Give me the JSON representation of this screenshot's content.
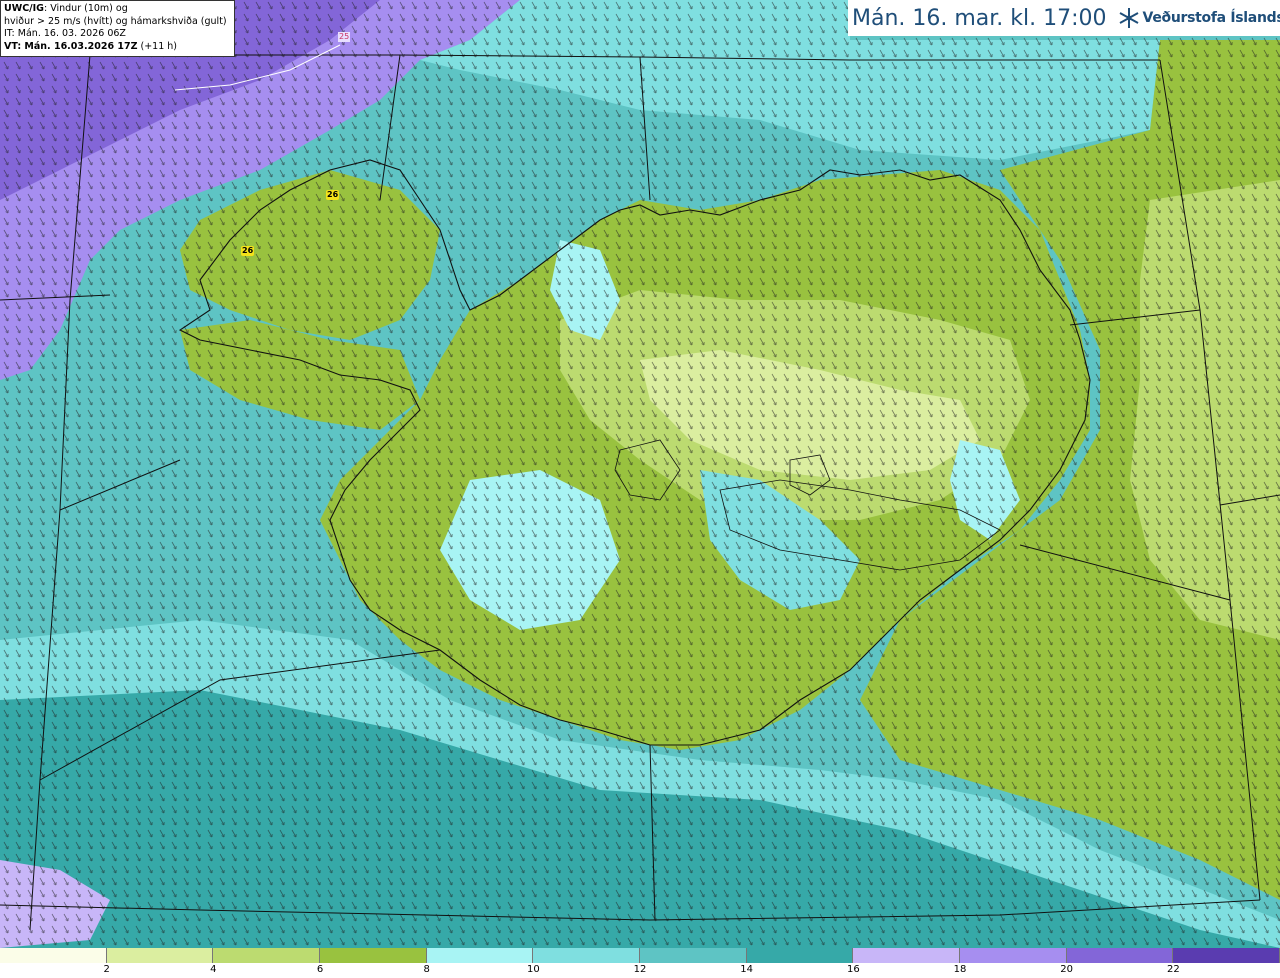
{
  "info_box": {
    "line1_bold": "UWC/IG",
    "line1_rest": ": Vindur (10m) og",
    "line2": "hviður > 25 m/s (hvítt) og hámarkshviða (gult)",
    "line3": "IT: Mán. 16. 03. 2026 06Z",
    "line4_bold": "VT: Mán. 16.03.2026 17Z",
    "line4_rest": " (+11 h)"
  },
  "title": {
    "valid_time": "Mán. 16. mar. kl. 17:00",
    "agency": "Veðurstofa Íslands"
  },
  "map_labels": {
    "gust_max_1": "26",
    "gust_max_2": "26",
    "contour_value": "25"
  },
  "legend": {
    "ticks": [
      "2",
      "4",
      "6",
      "8",
      "10",
      "12",
      "14",
      "16",
      "18",
      "20",
      "22"
    ],
    "colors": [
      "#fbfde8",
      "#dbeea0",
      "#bcdb70",
      "#99c23f",
      "#a8f4f4",
      "#7fdfe0",
      "#5ec4c4",
      "#36a9a8",
      "#c8b6f8",
      "#a68ef0",
      "#8366d8",
      "#5a3cb0"
    ]
  },
  "colors": {
    "ocean_calm": "#5ec4c4",
    "land_light": "#bcdb70",
    "land_dark": "#99c23f",
    "strong_wind": "#a68ef0",
    "title_blue": "#1f4e79"
  }
}
